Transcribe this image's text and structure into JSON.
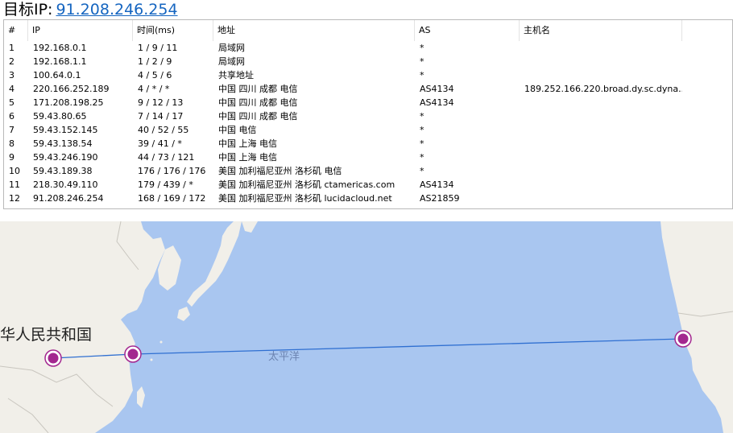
{
  "header": {
    "label": "目标IP:",
    "ip": "91.208.246.254"
  },
  "table": {
    "columns": [
      "#",
      "IP",
      "时间(ms)",
      "地址",
      "AS",
      "主机名"
    ],
    "rows": [
      [
        "1",
        "192.168.0.1",
        "1 / 9 / 11",
        "局域网",
        "*",
        ""
      ],
      [
        "2",
        "192.168.1.1",
        "1 / 2 / 9",
        "局域网",
        "*",
        ""
      ],
      [
        "3",
        "100.64.0.1",
        "4 / 5 / 6",
        "共享地址",
        "*",
        ""
      ],
      [
        "4",
        "220.166.252.189",
        "4 / * / *",
        "中国 四川 成都 电信",
        "AS4134",
        "189.252.166.220.broad.dy.sc.dyna..."
      ],
      [
        "5",
        "171.208.198.25",
        "9 / 12 / 13",
        "中国 四川 成都 电信",
        "AS4134",
        ""
      ],
      [
        "6",
        "59.43.80.65",
        "7 / 14 / 17",
        "中国 四川 成都 电信",
        "*",
        ""
      ],
      [
        "7",
        "59.43.152.145",
        "40 / 52 / 55",
        "中国 电信",
        "*",
        ""
      ],
      [
        "8",
        "59.43.138.54",
        "39 / 41 / *",
        "中国 上海 电信",
        "*",
        ""
      ],
      [
        "9",
        "59.43.246.190",
        "44 / 73 / 121",
        "中国 上海 电信",
        "*",
        ""
      ],
      [
        "10",
        "59.43.189.38",
        "176 / 176 / 176",
        "美国 加利福尼亚州 洛杉矶 电信",
        "*",
        ""
      ],
      [
        "11",
        "218.30.49.110",
        "179 / 439 / *",
        "美国 加利福尼亚州 洛杉矶 ctamericas.com",
        "AS4134",
        ""
      ],
      [
        "12",
        "91.208.246.254",
        "168 / 169 / 172",
        "美国 加利福尼亚州 洛杉矶 lucidacloud.net",
        "AS21859",
        ""
      ]
    ]
  },
  "map": {
    "country_label": "华人民共和国",
    "ocean_label": "太平洋",
    "colors": {
      "ocean": "#a9c6f0",
      "land": "#f1efe9",
      "route": "#2f6fd1",
      "marker": "#a3278f"
    }
  }
}
